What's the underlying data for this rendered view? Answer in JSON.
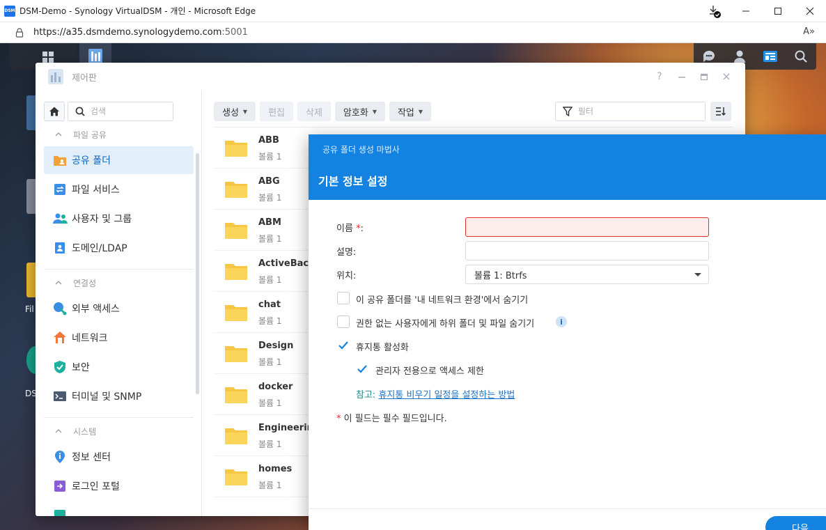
{
  "browser": {
    "app_icon_text": "DSM",
    "title": "DSM-Demo - Synology VirtualDSM - 개인 - Microsoft Edge",
    "url_host": "https://a35.dsmdemo.synologydemo.com",
    "url_port": ":5001",
    "read_aloud": "A»"
  },
  "desktop": {
    "labels": [
      "Fil",
      "DS"
    ]
  },
  "control_panel": {
    "title": "제어판",
    "help": "?",
    "search_placeholder": "검색",
    "sidebar": {
      "sections": [
        {
          "label": "파일 공유"
        },
        {
          "label": "연결성"
        },
        {
          "label": "시스템"
        }
      ],
      "items": [
        {
          "label": "공유 폴더",
          "icon": "shared-folder-icon"
        },
        {
          "label": "파일 서비스",
          "icon": "file-services-icon"
        },
        {
          "label": "사용자 및 그룹",
          "icon": "users-icon"
        },
        {
          "label": "도메인/LDAP",
          "icon": "domain-icon"
        },
        {
          "label": "외부 액세스",
          "icon": "external-access-icon"
        },
        {
          "label": "네트워크",
          "icon": "network-icon"
        },
        {
          "label": "보안",
          "icon": "security-shield-icon"
        },
        {
          "label": "터미널 및 SNMP",
          "icon": "terminal-icon"
        },
        {
          "label": "정보 센터",
          "icon": "info-center-icon"
        },
        {
          "label": "로그인 포털",
          "icon": "login-portal-icon"
        }
      ]
    },
    "toolbar": {
      "create": "생성",
      "edit": "편집",
      "delete": "삭제",
      "encrypt": "암호화",
      "action": "작업",
      "filter_placeholder": "필터"
    },
    "folders": [
      {
        "name": "ABB",
        "volume": "볼륨 1"
      },
      {
        "name": "ABG",
        "volume": "볼륨 1"
      },
      {
        "name": "ABM",
        "volume": "볼륨 1"
      },
      {
        "name": "ActiveBac",
        "volume": "볼륨 1"
      },
      {
        "name": "chat",
        "volume": "볼륨 1"
      },
      {
        "name": "Design",
        "volume": "볼륨 1"
      },
      {
        "name": "docker",
        "volume": "볼륨 1"
      },
      {
        "name": "Engineerin",
        "volume": "볼륨 1"
      },
      {
        "name": "homes",
        "volume": "볼륨 1"
      }
    ]
  },
  "wizard": {
    "supertitle": "공유 폴더 생성 마법사",
    "heading": "기본 정보 설정",
    "name_label": "이름",
    "name_req": "*",
    "name_colon": ":",
    "name_value": "",
    "desc_label": "설명:",
    "desc_value": "",
    "location_label": "위치:",
    "location_value": "볼륨 1:  Btrfs",
    "opt_hide_network": "이 공유 폴더를 '내 네트워크 환경'에서 숨기기",
    "opt_hide_unauth": "권한 없는 사용자에게 하위 폴더 및 파일 숨기기",
    "opt_recycle": "휴지통 활성화",
    "opt_admin_only": "관리자 전용으로 액세스 제한",
    "note_prefix": "참고: ",
    "note_link": "휴지통 비우기 일정을 설정하는 방법",
    "req_star": "*",
    "req_note": " 이 필드는 필수 필드입니다.",
    "next": "다음",
    "info": "i",
    "checks": {
      "hide_network": false,
      "hide_unauth": false,
      "recycle": true,
      "admin_only": true
    }
  },
  "colors": {
    "accent": "#1382e0",
    "error": "#e0322d",
    "folder": "#f7c744"
  }
}
